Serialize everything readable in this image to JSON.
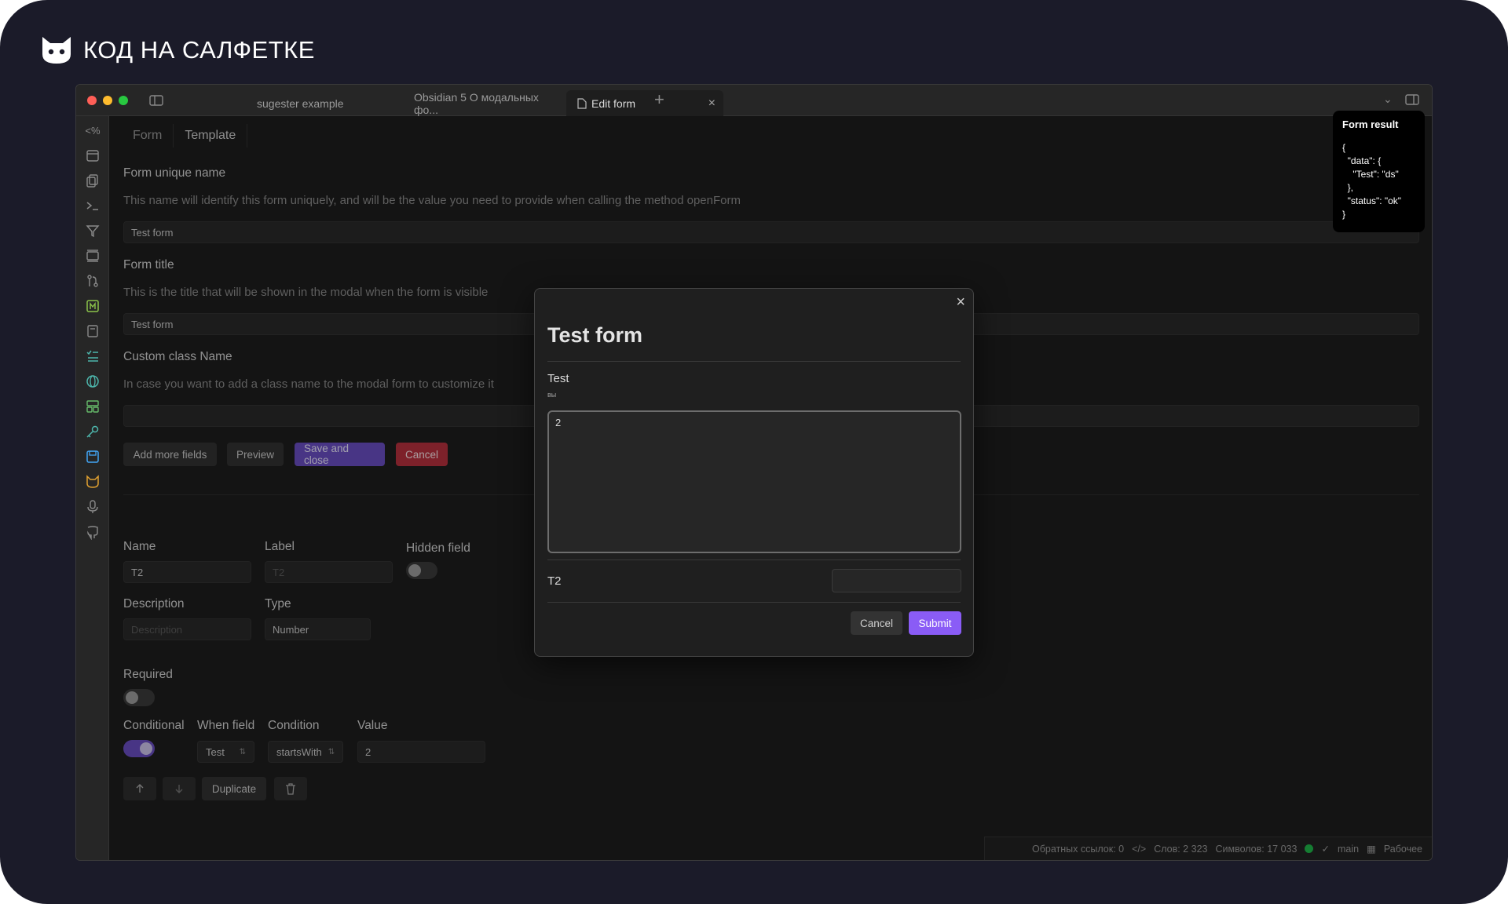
{
  "brand": {
    "text": "КОД НА САЛФЕТКЕ",
    "icon": "cat-logo-icon"
  },
  "tabs": [
    {
      "label": "sugester example"
    },
    {
      "label": "Obsidian 5 О модальных фо..."
    },
    {
      "label": "Edit form",
      "close": "×"
    }
  ],
  "tab_add": "+",
  "sidebar_icons": [
    "template-icon",
    "calendar-icon",
    "copy-icon",
    "terminal-icon",
    "filter-icon",
    "layers-icon",
    "git-icon",
    "kanban-icon",
    "book-icon",
    "list-icon",
    "globe-icon",
    "layout-icon",
    "key-icon",
    "save-icon",
    "cat-icon",
    "mic-icon",
    "github-icon"
  ],
  "sidebar_template_glyph": "<%",
  "subtabs": {
    "form": "Form",
    "template": "Template"
  },
  "form": {
    "unique_name_label": "Form unique name",
    "unique_name_desc": "This name will identify this form uniquely, and will be the value you need to provide when calling the method openForm",
    "unique_name_value": "Test form",
    "title_label": "Form title",
    "title_desc": "This is the title that will be shown in the modal when the form is visible",
    "title_value": "Test form",
    "class_label": "Custom class Name",
    "class_desc": "In case you want to add a class name to the modal form to customize it",
    "class_value": ""
  },
  "buttons": {
    "add_more": "Add more fields",
    "preview": "Preview",
    "save_close": "Save and close",
    "cancel": "Cancel",
    "duplicate": "Duplicate"
  },
  "field_editor": {
    "name_label": "Name",
    "name_value": "T2",
    "label_label": "Label",
    "label_placeholder": "T2",
    "hidden_label": "Hidden field",
    "hidden_on": false,
    "desc_label": "Description",
    "desc_placeholder": "Description",
    "type_label": "Type",
    "type_value": "Number",
    "required_label": "Required",
    "required_on": false,
    "conditional_label": "Conditional",
    "conditional_on": true,
    "when_label": "When field",
    "when_value": "Test",
    "condition_label": "Condition",
    "condition_value": "startsWith",
    "value_label": "Value",
    "value_value": "2"
  },
  "modal": {
    "title": "Test form",
    "field1_label": "Test",
    "field1_hint": "вы",
    "field1_value": "2",
    "field2_label": "T2",
    "cancel": "Cancel",
    "submit": "Submit",
    "close": "×"
  },
  "result": {
    "title": "Form result",
    "body": "{\n  \"data\": {\n    \"Test\": \"ds\"\n  },\n  \"status\": \"ok\"\n}"
  },
  "status": {
    "backlinks": "Обратных ссылок: 0",
    "words": "Слов: 2 323",
    "chars": "Символов: 17 033",
    "branch": "main",
    "workspace": "Рабочее"
  }
}
